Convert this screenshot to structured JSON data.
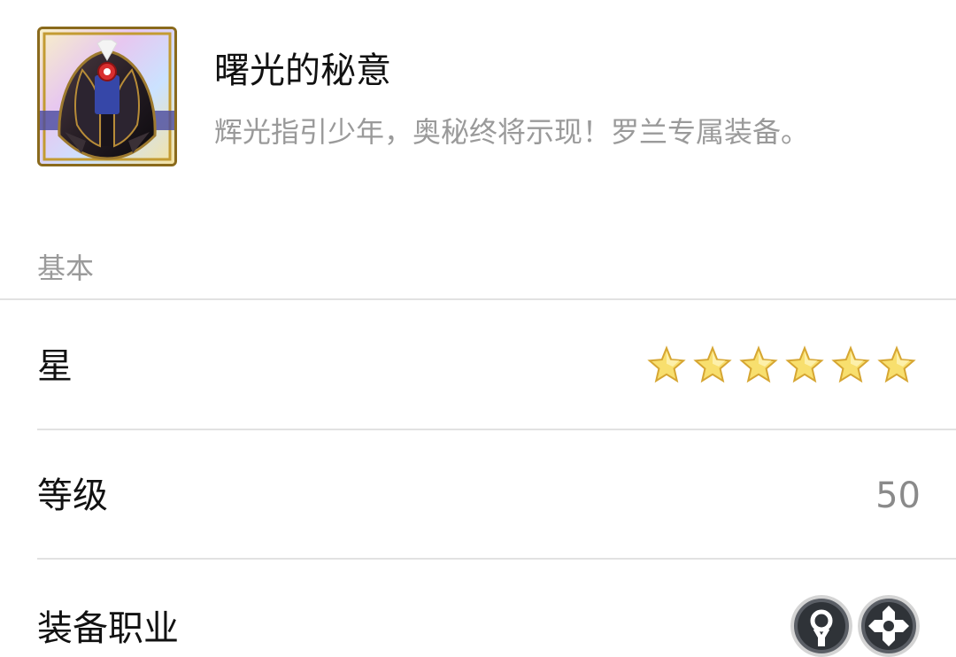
{
  "item": {
    "name": "曙光的秘意",
    "description": "辉光指引少年，奥秘终将示现！罗兰专属装备。",
    "icon": "dark-cloak-equipment-icon"
  },
  "section": {
    "label": "基本"
  },
  "rows": {
    "star": {
      "label": "星",
      "value": 6,
      "icon": "star-icon"
    },
    "level": {
      "label": "等级",
      "value": "50"
    },
    "job": {
      "label": "装备职业",
      "icons": [
        "priest-class-icon",
        "cleric-cross-class-icon"
      ]
    }
  },
  "colors": {
    "accent_gold": "#f2c94c",
    "star_fill": "#f8df6e",
    "divider": "#e2e2e2",
    "muted_text": "#9a9a9a",
    "class_icon_bg": "#4d5157"
  }
}
